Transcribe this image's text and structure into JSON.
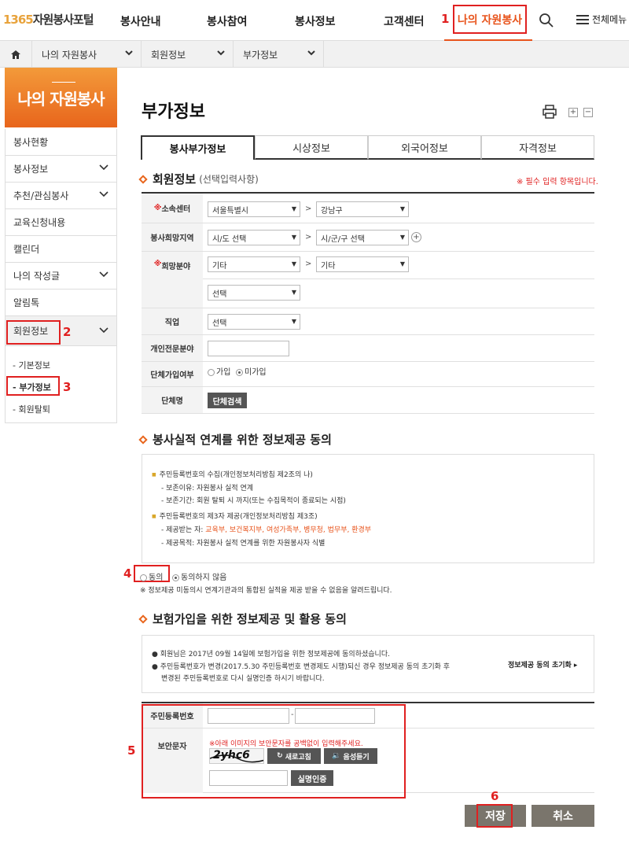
{
  "header": {
    "logo_num": "1365",
    "logo_text": "자원봉사포털",
    "nav": [
      "봉사안내",
      "봉사참여",
      "봉사정보",
      "고객센터"
    ],
    "nav_mine": "나의 자원봉사",
    "menu_all": "전체메뉴",
    "marks": {
      "m1": "1",
      "m2": "2",
      "m3": "3",
      "m4": "4",
      "m5": "5",
      "m6": "6"
    }
  },
  "breadcrumb": [
    "나의 자원봉사",
    "회원정보",
    "부가정보"
  ],
  "sidebar": {
    "banner": "나의 자원봉사",
    "items": [
      "봉사현황",
      "봉사정보",
      "추천/관심봉사",
      "교육신청내용",
      "캘린더",
      "나의 작성글",
      "알림톡",
      "회원정보"
    ],
    "subitems": [
      "- 기본정보",
      "- 부가정보",
      "- 회원탈퇴"
    ]
  },
  "main": {
    "title": "부가정보",
    "tabs": [
      "봉사부가정보",
      "시상정보",
      "외국어정보",
      "자격정보"
    ],
    "section1": {
      "title": "회원정보",
      "subtitle": "(선택입력사항)",
      "required_note": "※ 필수 입력 항목입니다."
    },
    "form": {
      "center_label_star": "※",
      "center_label": "소속센터",
      "center_city": "서울특별시",
      "center_district": "강남구",
      "hope_area_label": "봉사희망지역",
      "hope_city": "시/도 선택",
      "hope_district": "시/군/구 선택",
      "field_label_star": "※",
      "field_label": "희망분야",
      "field_1": "기타",
      "field_2": "기타",
      "field_3": "선택",
      "job_label": "직업",
      "job_value": "선택",
      "expertise_label": "개인전문분야",
      "group_join_label": "단체가입여부",
      "group_join_yes": "가입",
      "group_join_no": "미가입",
      "group_name_label": "단체명",
      "group_search_btn": "단체검색",
      "gt": ">"
    },
    "section2": {
      "title": "봉사실적 연계를 위한 정보제공 동의",
      "b1": "주민등록번호의 수집(개인정보처리방침 제2조의 나)",
      "b1_l1": "- 보존이유: 자원봉사 실적 연계",
      "b1_l2": "- 보존기간: 회원 탈퇴 시 까지(또는 수집목적이 종료되는 시점)",
      "b2": "주민등록번호의 제3자 제공(개인정보처리방침 제3조)",
      "b2_l1_prefix": "- 제공받는 자: ",
      "b2_l1_red": "교육부, 보건복지부, 여성가족부, 병무청, 법무부, 환경부",
      "b2_l2": "- 제공목적: 자원봉사 실적 연계를 위한 자원봉사자 식별",
      "agree": "동의",
      "disagree": "동의하지 않음",
      "notice": "※ 정보제공 미동의시 연계기관과의 통합된 실적을 제공 받을 수 없음을 알려드립니다."
    },
    "section3": {
      "title": "보험가입을 위한 정보제공 및 활용 동의",
      "l1": "● 회원님은 2017년 09월 14일에 보험가입을 위한 정보제공에 동의하셨습니다.",
      "l2": "● 주민등록번호가 변경(2017.5.30 주민등록번호 변경제도 시행)되신 경우 정보제공 동의 초기화 후",
      "l3": "변경된 주민등록번호로 다시 실명인증 하시기 바랍니다.",
      "reset_link": "정보제공 동의 초기화 ▸",
      "ssn_label": "주민등록번호",
      "ssn_dash": "-",
      "captcha_label": "보안문자",
      "captcha_note": "※아래 이미지의 보안문자를 공백없이 입력해주세요.",
      "captcha_text": "2yhc6",
      "refresh_btn": "새로고침",
      "audio_btn": "음성듣기",
      "verify_btn": "실명인증"
    },
    "save_btn": "저장",
    "cancel_btn": "취소"
  }
}
